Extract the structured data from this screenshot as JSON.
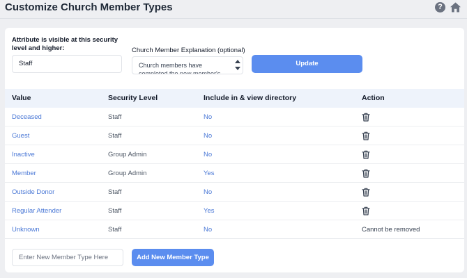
{
  "header": {
    "title": "Customize Church Member Types",
    "help_glyph": "?",
    "help_icon": "help-icon",
    "home_icon": "home-icon"
  },
  "settings": {
    "security_label": "Attribute is visible at this security level and higher:",
    "security_value": "Staff",
    "explanation_label": "Church Member Explanation (optional)",
    "explanation_value": "Church members have completed the new member's",
    "update_label": "Update"
  },
  "table": {
    "columns": [
      "Value",
      "Security Level",
      "Include in & view directory",
      "Action"
    ],
    "rows": [
      {
        "value": "Deceased",
        "security": "Staff",
        "directory": "No",
        "action": "delete-icon"
      },
      {
        "value": "Guest",
        "security": "Staff",
        "directory": "No",
        "action": "delete-icon"
      },
      {
        "value": "Inactive",
        "security": "Group Admin",
        "directory": "No",
        "action": "delete-icon"
      },
      {
        "value": "Member",
        "security": "Group Admin",
        "directory": "Yes",
        "action": "delete-icon"
      },
      {
        "value": "Outside Donor",
        "security": "Staff",
        "directory": "No",
        "action": "delete-icon"
      },
      {
        "value": "Regular Attender",
        "security": "Staff",
        "directory": "Yes",
        "action": "delete-icon"
      },
      {
        "value": "Unknown",
        "security": "Staff",
        "directory": "No",
        "action_text": "Cannot be removed"
      }
    ]
  },
  "footer": {
    "new_type_placeholder": "Enter New Member Type Here",
    "add_label": "Add New Member Type"
  },
  "colors": {
    "accent": "#5b8def",
    "link": "#4a78d6",
    "background": "#eeeff2"
  }
}
